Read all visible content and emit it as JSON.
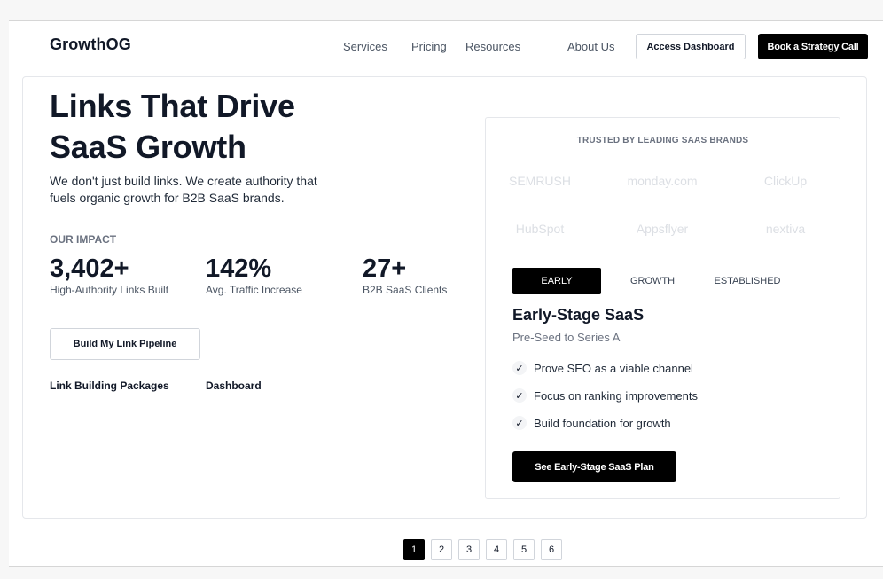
{
  "nav": {
    "logo": "GrowthOG",
    "links": [
      "Services",
      "Pricing",
      "Resources",
      "About Us"
    ],
    "access_label": "Access Dashboard",
    "book_label": "Book a Strategy Call"
  },
  "hero": {
    "headline_line1": "Links That Drive",
    "headline_line2": "SaaS Growth",
    "subcopy": "We don't just build links. We create authority that fuels organic growth for B2B SaaS brands.",
    "impact_label": "OUR IMPACT",
    "stats": [
      {
        "value": "3,402+",
        "label": "High-Authority Links Built"
      },
      {
        "value": "142%",
        "label": "Avg. Traffic Increase"
      },
      {
        "value": "27+",
        "label": "B2B SaaS Clients"
      }
    ],
    "cta_label": "Build My Link Pipeline",
    "links": [
      "Link Building Packages",
      "Dashboard"
    ]
  },
  "panel": {
    "trusted_label": "TRUSTED BY LEADING SAAS BRANDS",
    "brands": [
      "SEMRUSH",
      "monday.com",
      "ClickUp",
      "HubSpot",
      "Appsflyer",
      "nextiva"
    ],
    "tabs": [
      "EARLY",
      "GROWTH",
      "ESTABLISHED"
    ],
    "active_tab": "EARLY",
    "plan_title": "Early-Stage SaaS",
    "plan_subtitle": "Pre-Seed to Series A",
    "features": [
      "Prove SEO as a viable channel",
      "Focus on ranking improvements",
      "Build foundation for growth"
    ],
    "plan_cta": "See Early-Stage SaaS Plan"
  },
  "pagination": {
    "pages": [
      "1",
      "2",
      "3",
      "4",
      "5",
      "6"
    ],
    "current": "1"
  },
  "icons": {
    "feature_check": "check-icon"
  },
  "colors": {
    "primary": "#000000",
    "text": "#111827",
    "muted": "#6b7280",
    "brand_logo_gray": "#dcdfe4"
  }
}
